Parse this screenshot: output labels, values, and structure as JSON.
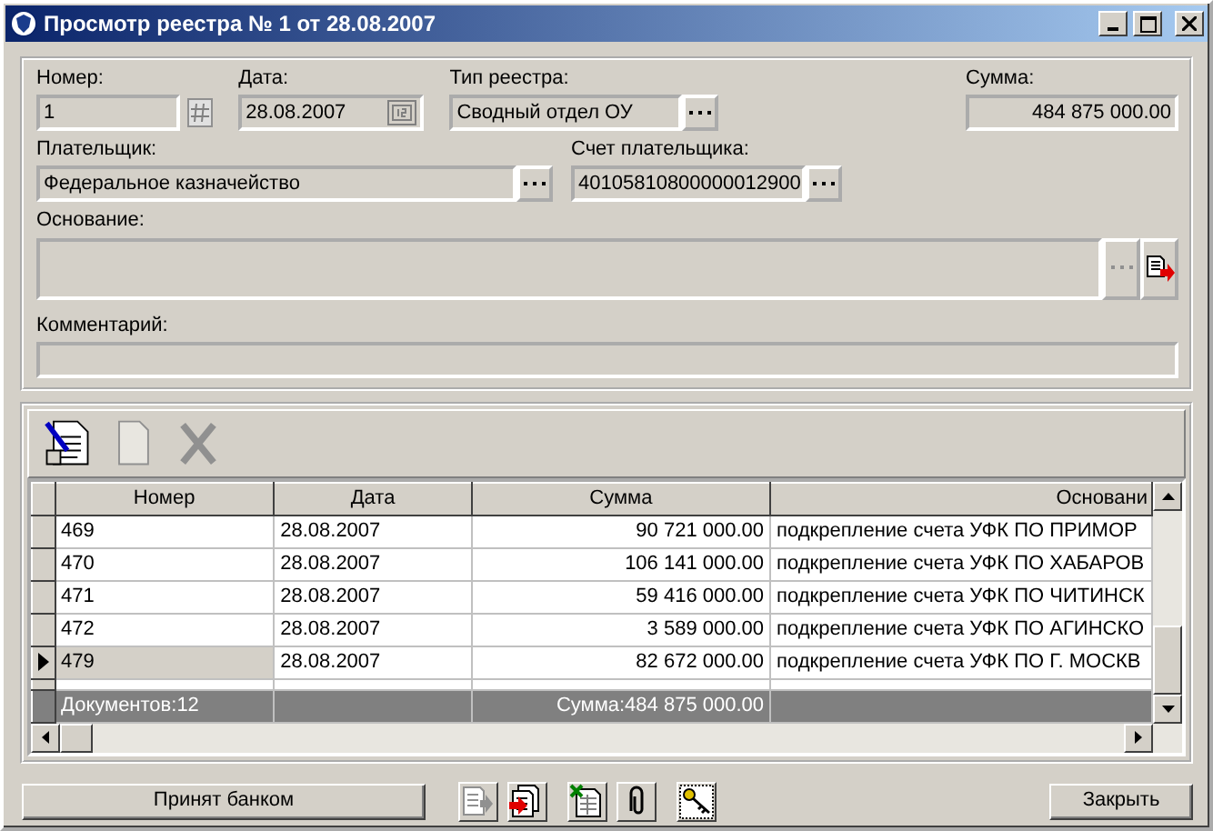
{
  "window": {
    "title": "Просмотр реестра № 1 от 28.08.2007"
  },
  "number": {
    "label": "Номер:",
    "value": "1"
  },
  "date": {
    "label": "Дата:",
    "value": "28.08.2007"
  },
  "registry_type": {
    "label": "Тип реестра:",
    "value": "Сводный отдел ОУ"
  },
  "sum": {
    "label": "Сумма:",
    "value": "484 875 000.00"
  },
  "payer": {
    "label": "Плательщик:",
    "value": "Федеральное казначейство"
  },
  "payer_account": {
    "label": "Счет плательщика:",
    "value": "40105810800000012900"
  },
  "basis": {
    "label": "Основание:"
  },
  "comment": {
    "label": "Комментарий:"
  },
  "toolbar": [
    {
      "kind": "edit",
      "disabled": false
    },
    {
      "kind": "new",
      "disabled": true
    },
    {
      "kind": "delete",
      "disabled": true
    }
  ],
  "table": {
    "columns": [
      "Номер",
      "Дата",
      "Сумма",
      "Основани"
    ],
    "rows": [
      {
        "cells": [
          "469",
          "28.08.2007",
          "90 721 000.00",
          "подкрепление счета УФК ПО ПРИМОР"
        ],
        "selected": false
      },
      {
        "cells": [
          "470",
          "28.08.2007",
          "106 141 000.00",
          "подкрепление счета УФК ПО ХАБАРОВ"
        ],
        "selected": false
      },
      {
        "cells": [
          "471",
          "28.08.2007",
          "59 416 000.00",
          "подкрепление счета УФК ПО ЧИТИНСК"
        ],
        "selected": false
      },
      {
        "cells": [
          "472",
          "28.08.2007",
          "3 589 000.00",
          "подкрепление счета УФК ПО АГИНСКО"
        ],
        "selected": false
      },
      {
        "cells": [
          "479",
          "28.08.2007",
          "82 672 000.00",
          "подкрепление счета УФК ПО Г. МОСКВ"
        ],
        "selected": true
      }
    ],
    "footer": {
      "count": "Документов:12",
      "total": "Сумма:484 875 000.00"
    }
  },
  "accept_button": "Принят банком",
  "actions": [
    {
      "kind": "export",
      "disabled": true
    },
    {
      "kind": "import",
      "disabled": false
    },
    {
      "kind": "excel",
      "disabled": false
    },
    {
      "kind": "attach",
      "disabled": false
    },
    {
      "kind": "keys",
      "disabled": false
    }
  ],
  "close_button": "Закрыть"
}
